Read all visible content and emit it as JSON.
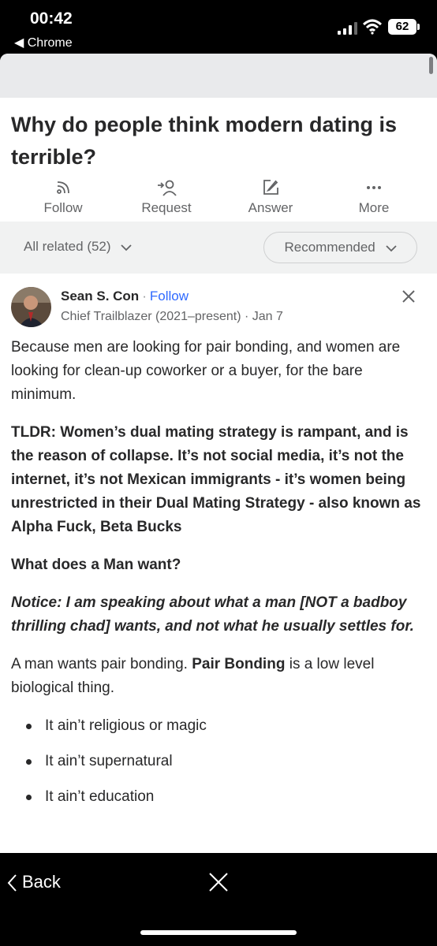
{
  "status_bar": {
    "time": "00:42",
    "back_app": "◀ Chrome",
    "battery": "62"
  },
  "question": {
    "title": "Why do people think modern dating is terrible?"
  },
  "actions": [
    {
      "label": "Follow",
      "icon": "follow-icon"
    },
    {
      "label": "Request",
      "icon": "request-icon"
    },
    {
      "label": "Answer",
      "icon": "answer-icon"
    },
    {
      "label": "More",
      "icon": "more-icon"
    }
  ],
  "filters": {
    "all_related": "All related (52)",
    "sort": "Recommended"
  },
  "answer": {
    "author_name": "Sean S. Con",
    "separator": "·",
    "follow": "Follow",
    "credential": "Chief Trailblazer (2021–present) · Jan 7",
    "p1": "Because men are looking for pair bonding, and women are looking for clean-up coworker or a buyer, for the bare minimum.",
    "tldr": "TLDR: Women’s dual mating strategy is rampant, and is the reason of collapse. It’s not social media, it’s not the internet, it’s not Mexican immigrants - it’s women being unrestricted in their Dual Mating Strategy - also known as Alpha Fuck, Beta Bucks",
    "heading": "What does a Man want?",
    "notice": "Notice: I am speaking about what a man [NOT a badboy thrilling chad] wants, and not what he usually settles for.",
    "p2_prefix": "A man wants pair bonding. ",
    "p2_bold": "Pair Bonding",
    "p2_suffix": " is a low level biological thing.",
    "bullets": [
      "It ain’t religious or magic",
      "It ain’t supernatural",
      "It ain’t education"
    ]
  },
  "bottom": {
    "back": "Back"
  },
  "colors": {
    "accent": "#2e69ff",
    "text": "#282829",
    "muted": "#636466",
    "filter_bg": "#f1f2f2"
  }
}
